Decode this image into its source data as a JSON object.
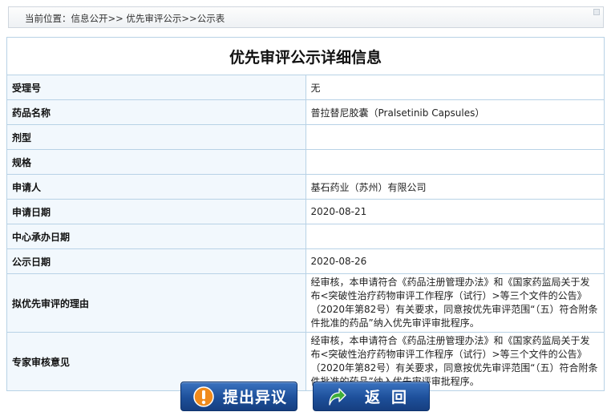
{
  "breadcrumb": "当前位置：信息公开>> 优先审评公示>>公示表",
  "title": "优先审评公示详细信息",
  "fields": [
    {
      "label": "受理号",
      "value": "无"
    },
    {
      "label": "药品名称",
      "value": "普拉替尼胶囊（Pralsetinib Capsules）"
    },
    {
      "label": "剂型",
      "value": ""
    },
    {
      "label": "规格",
      "value": ""
    },
    {
      "label": "申请人",
      "value": "基石药业（苏州）有限公司"
    },
    {
      "label": "申请日期",
      "value": "2020-08-21"
    },
    {
      "label": "中心承办日期",
      "value": ""
    },
    {
      "label": "公示日期",
      "value": "2020-08-26"
    },
    {
      "label": "拟优先审评的理由",
      "value": "经审核，本申请符合《药品注册管理办法》和《国家药监局关于发布<突破性治疗药物审评工作程序（试行）>等三个文件的公告》（2020年第82号）有关要求，同意按优先审评范围“（五）符合附条件批准的药品”纳入优先审评审批程序。"
    },
    {
      "label": "专家审核意见",
      "value": "经审核，本申请符合《药品注册管理办法》和《国家药监局关于发布<突破性治疗药物审评工作程序（试行）>等三个文件的公告》（2020年第82号）有关要求，同意按优先审评范围“（五）符合附条件批准的药品”纳入优先审评审批程序。"
    }
  ],
  "buttons": {
    "objection_label": "提出异议",
    "back_label": "返回"
  },
  "colors": {
    "button_blue": "#1d4f9a",
    "objection_icon": "#f08a1c",
    "back_icon": "#3fae3a",
    "label_bg": "#f2f8fd",
    "border": "#b8d2e6"
  }
}
